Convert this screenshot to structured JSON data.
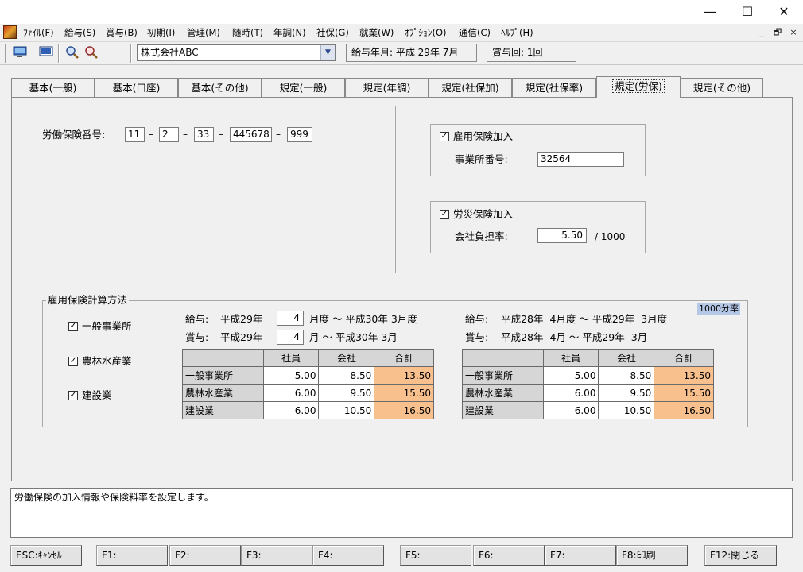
{
  "window": {
    "minimize": "—",
    "maximize": "☐",
    "close": "✕"
  },
  "menu": [
    "ﾌｧｲﾙ(F)",
    "給与(S)",
    "賞与(B)",
    "初期(I)",
    "管理(M)",
    "随時(T)",
    "年調(N)",
    "社保(G)",
    "就業(W)",
    "ｵﾌﾟｼｮﾝ(O)",
    "通信(C)",
    "ﾍﾙﾌﾟ(H)"
  ],
  "mdi": {
    "min": "_",
    "restore": "🗗",
    "close": "×"
  },
  "toolbar": {
    "company": "株式会社ABC",
    "pay_month": "給与年月: 平成 29年  7月",
    "bonus_count": "賞与回: 1回"
  },
  "tabs": [
    "基本(一般)",
    "基本(口座)",
    "基本(その他)",
    "規定(一般)",
    "規定(年調)",
    "規定(社保加)",
    "規定(社保率)",
    "規定(労保)",
    "規定(その他)"
  ],
  "active_tab": "規定(労保)",
  "labor_insurance": {
    "label": "労働保険番号:",
    "parts": [
      "11",
      "2",
      "33",
      "445678",
      "999"
    ],
    "sep": "–"
  },
  "employment_insurance": {
    "check_label": "雇用保険加入",
    "checked": true,
    "office_label": "事業所番号:",
    "office_no": "32564"
  },
  "accident_insurance": {
    "check_label": "労災保険加入",
    "checked": true,
    "rate_label": "会社負担率:",
    "rate": "5.50",
    "unit": "/ 1000"
  },
  "calc": {
    "title": "雇用保険計算方法",
    "per_mille": "1000分率",
    "types": [
      {
        "label": "一般事業所",
        "checked": true
      },
      {
        "label": "農林水産業",
        "checked": true
      },
      {
        "label": "建設業",
        "checked": true
      }
    ],
    "left": {
      "salary_label": "給与:",
      "salary_from_era": "平成29年",
      "salary_month": "4",
      "salary_to": "月度 〜 平成30年  3月度",
      "bonus_label": "賞与:",
      "bonus_from_era": "平成29年",
      "bonus_month": "4",
      "bonus_to": "月 〜 平成30年  3月",
      "headers": [
        "",
        "社員",
        "会社",
        "合計"
      ],
      "rows": [
        [
          "一般事業所",
          "5.00",
          "8.50",
          "13.50"
        ],
        [
          "農林水産業",
          "6.00",
          "9.50",
          "15.50"
        ],
        [
          "建設業",
          "6.00",
          "10.50",
          "16.50"
        ]
      ]
    },
    "right": {
      "salary_line": "給与:    平成28年  4月度 〜 平成29年  3月度",
      "bonus_line": "賞与:    平成28年  4月 〜 平成29年  3月",
      "headers": [
        "",
        "社員",
        "会社",
        "合計"
      ],
      "rows": [
        [
          "一般事業所",
          "5.00",
          "8.50",
          "13.50"
        ],
        [
          "農林水産業",
          "6.00",
          "9.50",
          "15.50"
        ],
        [
          "建設業",
          "6.00",
          "10.50",
          "16.50"
        ]
      ]
    }
  },
  "message": "労働保険の加入情報や保険料率を設定します。",
  "fkeys": [
    "ESC:ｷｬﾝｾﾙ",
    "F1:",
    "F2:",
    "F3:",
    "F4:",
    "F5:",
    "F6:",
    "F7:",
    "F8:印刷",
    "F12:閉じる"
  ]
}
